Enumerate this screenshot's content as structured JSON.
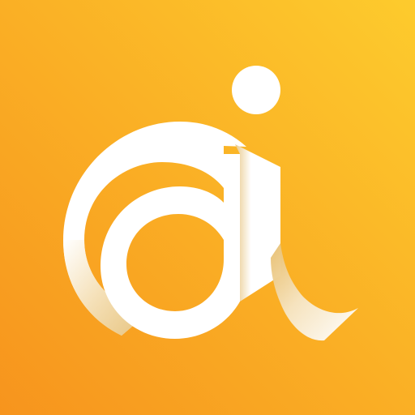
{
  "icon": {
    "name": "app-logo-icon",
    "colors": {
      "background_start": "#F7941D",
      "background_end": "#FDCB2D",
      "glyph": "#FFFFFF",
      "glyph_shade": "#E9C98A"
    }
  }
}
